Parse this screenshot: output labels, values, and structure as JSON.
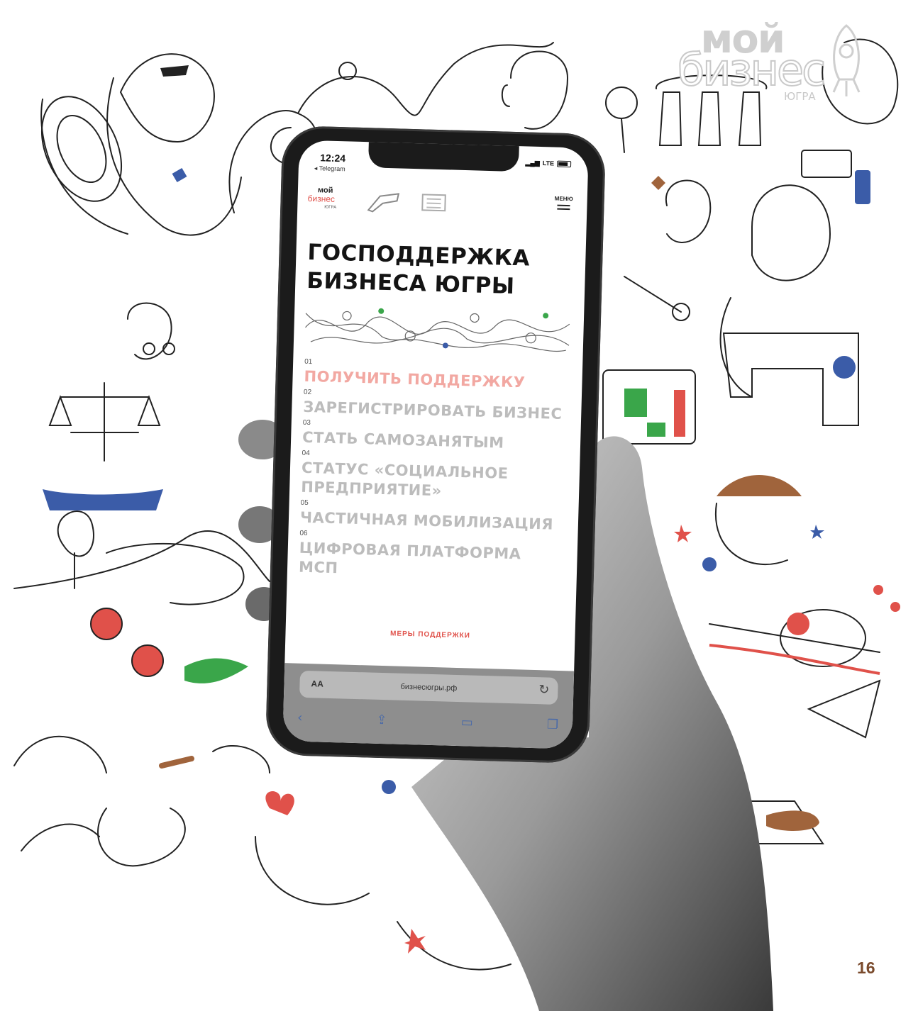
{
  "brand": {
    "line1": "мой",
    "line2": "бизнес",
    "region": "ЮГРА"
  },
  "page_number": "16",
  "phone": {
    "status_bar": {
      "time": "12:24",
      "back_app": "◂ Telegram",
      "signal_text": "LTE"
    },
    "site": {
      "logo": {
        "line1": "мой",
        "line2": "бизнес",
        "line3": "ЮГРА"
      },
      "menu_label": "МЕНЮ",
      "hero_title": [
        "ГОСПОДДЕРЖКА",
        "БИЗНЕСА ЮГРЫ"
      ],
      "items": [
        {
          "num": "01",
          "label": "ПОЛУЧИТЬ ПОДДЕРЖКУ",
          "active": true
        },
        {
          "num": "02",
          "label": "ЗАРЕГИСТРИРОВАТЬ БИЗНЕС",
          "active": false
        },
        {
          "num": "03",
          "label": "СТАТЬ САМОЗАНЯТЫМ",
          "active": false
        },
        {
          "num": "04",
          "label": "СТАТУС «СОЦИАЛЬНОЕ\nПРЕДПРИЯТИЕ»",
          "active": false
        },
        {
          "num": "05",
          "label": "ЧАСТИЧНАЯ МОБИЛИЗАЦИЯ",
          "active": false
        },
        {
          "num": "06",
          "label": "ЦИФРОВАЯ ПЛАТФОРМА\nМСП",
          "active": false
        }
      ],
      "measures_button": "МЕРЫ ПОДДЕРЖКИ"
    },
    "browser": {
      "aa_label": "AA",
      "url": "бизнесюгры.рф",
      "reload_icon": "reload-icon"
    }
  },
  "colors": {
    "accent_red": "#e0514a",
    "accent_blue": "#3b5ca8",
    "accent_green": "#3aa64a",
    "line": "#222222"
  }
}
